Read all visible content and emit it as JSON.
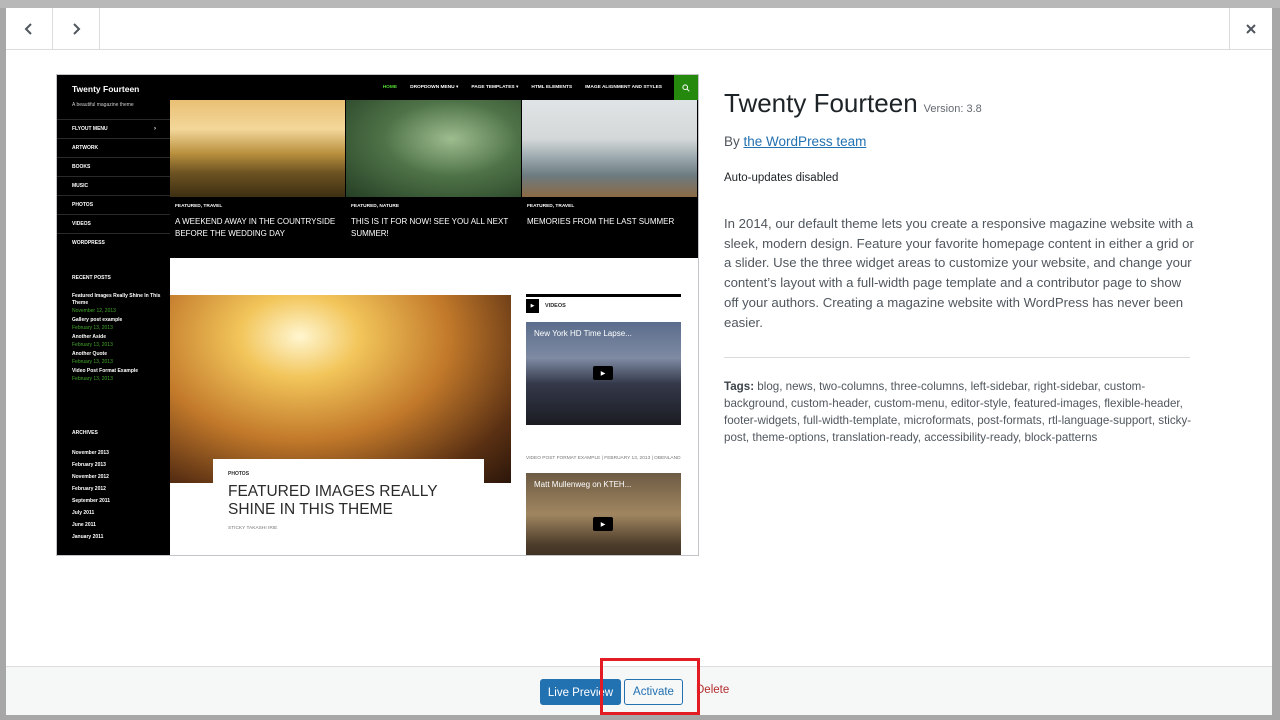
{
  "theme": {
    "name": "Twenty Fourteen",
    "version_label": "Version: 3.8",
    "author_prefix": "By",
    "author_link": "the WordPress team",
    "auto_updates": "Auto-updates disabled",
    "description": "In 2014, our default theme lets you create a responsive magazine website with a sleek, modern design. Feature your favorite homepage content in either a grid or a slider. Use the three widget areas to customize your website, and change your content’s layout with a full-width page template and a contributor page to show off your authors. Creating a magazine website with WordPress has never been easier.",
    "tags_label": "Tags:",
    "tags": "blog, news, two-columns, three-columns, left-sidebar, right-sidebar, custom-background, custom-header, custom-menu, editor-style, featured-images, flexible-header, footer-widgets, full-width-template, microformats, post-formats, rtl-language-support, sticky-post, theme-options, translation-ready, accessibility-ready, block-patterns"
  },
  "footer": {
    "live_preview_label": "Live Preview",
    "activate_label": "Activate",
    "delete_label": "Delete"
  },
  "screenshot": {
    "site_title": "Twenty Fourteen",
    "tagline": "A beautiful magazine theme",
    "menu": [
      "HOME",
      "DROPDOWN MENU ▾",
      "PAGE TEMPLATES ▾",
      "HTML ELEMENTS",
      "IMAGE ALIGNMENT AND STYLES"
    ],
    "side_nav": [
      "FLYOUT MENU",
      "ARTWORK",
      "BOOKS",
      "MUSIC",
      "PHOTOS",
      "VIDEOS",
      "WORDPRESS"
    ],
    "recent_posts_heading": "RECENT POSTS",
    "recent_posts": [
      {
        "title": "Featured Images Really Shine In This Theme",
        "date": "November 12, 2013"
      },
      {
        "title": "Gallery post example",
        "date": "February 13, 2013"
      },
      {
        "title": "Another Aside",
        "date": "February 13, 2013"
      },
      {
        "title": "Another Quote",
        "date": "February 13, 2013"
      },
      {
        "title": "Video Post Format Example",
        "date": "February 13, 2013"
      }
    ],
    "archives_heading": "ARCHIVES",
    "archives": [
      "November 2013",
      "February 2013",
      "November 2012",
      "February 2012",
      "September 2011",
      "July 2011",
      "June 2011",
      "January 2011"
    ],
    "featured": [
      {
        "cat": "FEATURED, TRAVEL",
        "title": "A WEEKEND AWAY IN THE COUNTRYSIDE BEFORE THE WEDDING DAY"
      },
      {
        "cat": "FEATURED, NATURE",
        "title": "THIS IS IT FOR NOW! SEE YOU ALL NEXT SUMMER!"
      },
      {
        "cat": "FEATURED, TRAVEL",
        "title": "MEMORIES FROM THE LAST SUMMER"
      }
    ],
    "big_post": {
      "cat": "PHOTOS",
      "title": "FEATURED IMAGES REALLY SHINE IN THIS THEME",
      "meta": "STICKY    TAKASHI IRIE"
    },
    "videos_heading": "VIDEOS",
    "video1_title": "New York HD Time Lapse...",
    "video1_meta": "VIDEO POST FORMAT EXAMPLE | FEBRUARY 13, 2013 | OBENLAND",
    "video2_title": "Matt Mullenweg on KTEH..."
  },
  "colors": {
    "accent": "#2271b1",
    "delete": "#b32d2e",
    "highlight": "#e31b23",
    "theme_green": "#24890d"
  },
  "icons": {
    "prev": "chevron-left-icon",
    "next": "chevron-right-icon",
    "close": "close-icon"
  }
}
